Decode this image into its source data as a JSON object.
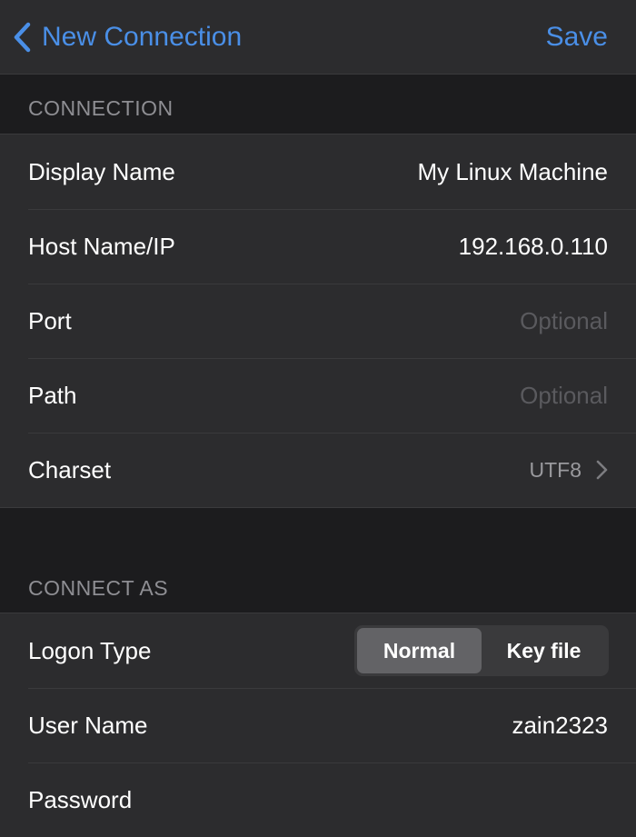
{
  "nav": {
    "back_label": "New Connection",
    "save_label": "Save"
  },
  "sections": {
    "connection_header": "CONNECTION",
    "connect_as_header": "CONNECT AS"
  },
  "connection": {
    "display_name_label": "Display Name",
    "display_name_value": "My Linux Machine",
    "host_label": "Host Name/IP",
    "host_value": "192.168.0.110",
    "port_label": "Port",
    "port_placeholder": "Optional",
    "path_label": "Path",
    "path_placeholder": "Optional",
    "charset_label": "Charset",
    "charset_value": "UTF8"
  },
  "connect_as": {
    "logon_type_label": "Logon Type",
    "logon_options": [
      "Normal",
      "Key file"
    ],
    "logon_selected": "Normal",
    "user_name_label": "User Name",
    "user_name_value": "zain2323",
    "password_label": "Password"
  },
  "colors": {
    "accent": "#4a8fe7",
    "background": "#1c1c1e",
    "cell": "#2c2c2e",
    "separator": "#3a3a3c",
    "secondary_text": "#8e8e93"
  },
  "icons": {
    "back": "chevron-left-icon",
    "disclosure": "chevron-right-icon"
  }
}
